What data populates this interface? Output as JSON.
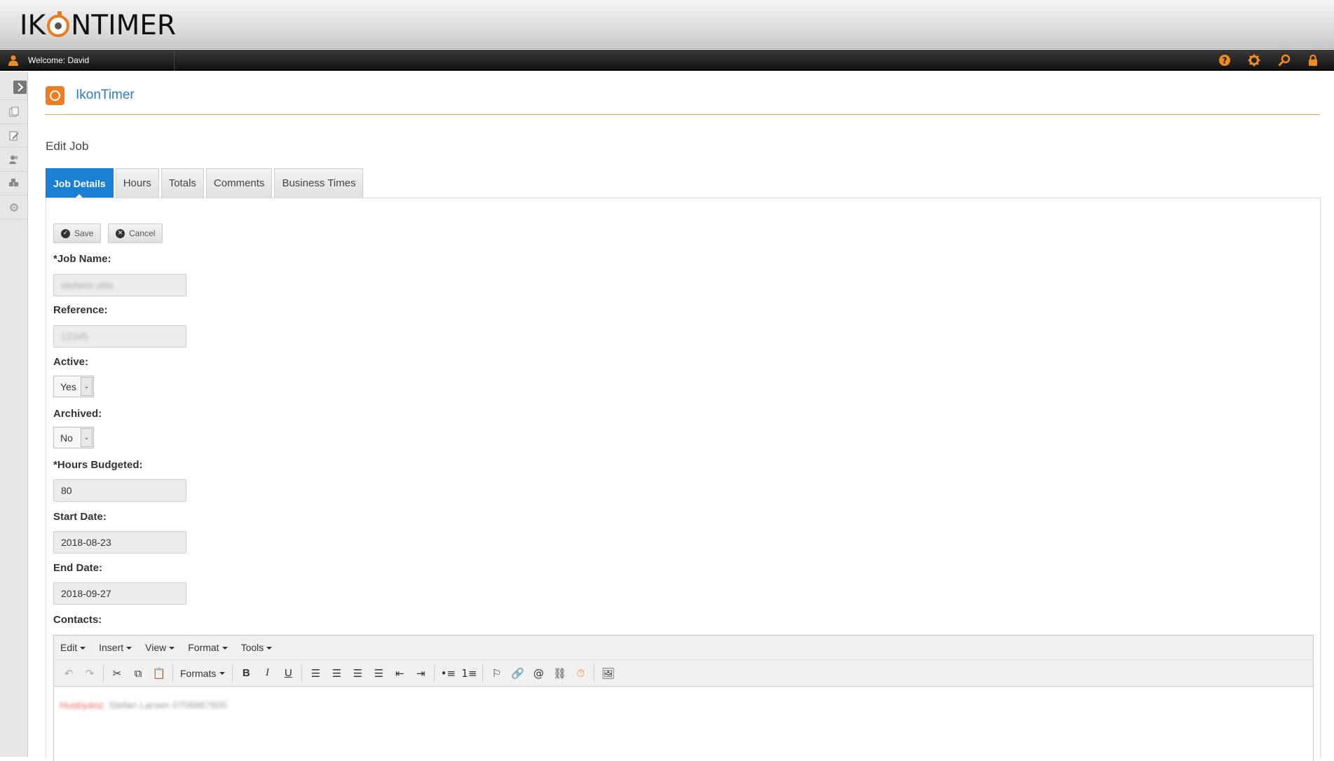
{
  "header": {
    "logo_prefix": "IK",
    "logo_suffix": "NTIMER",
    "welcome": "Welcome: David"
  },
  "app": {
    "title": "IkonTimer"
  },
  "page": {
    "title": "Edit Job"
  },
  "tabs": [
    {
      "label": "Job Details",
      "active": true
    },
    {
      "label": "Hours"
    },
    {
      "label": "Totals"
    },
    {
      "label": "Comments"
    },
    {
      "label": "Business Times"
    }
  ],
  "actions": {
    "save": "Save",
    "cancel": "Cancel"
  },
  "form": {
    "job_name": {
      "label": "*Job Name:",
      "value": "stefano villa"
    },
    "reference": {
      "label": "Reference:",
      "value": "12345"
    },
    "active": {
      "label": "Active:",
      "value": "Yes"
    },
    "archived": {
      "label": "Archived:",
      "value": "No"
    },
    "hours_budgeted": {
      "label": "*Hours Budgeted:",
      "value": "80"
    },
    "start_date": {
      "label": "Start Date:",
      "value": "2018-08-23"
    },
    "end_date": {
      "label": "End Date:",
      "value": "2018-09-27"
    },
    "contacts": {
      "label": "Contacts:"
    }
  },
  "editor": {
    "menus": [
      "Edit",
      "Insert",
      "View",
      "Format",
      "Tools"
    ],
    "formats_label": "Formats",
    "content_label": "Husbyanz:",
    "content_text": "Stefan Larsen 0706867600"
  },
  "colors": {
    "accent": "#1b80d3",
    "brand_orange": "#ed7d22",
    "title_blue": "#2a7ec2"
  }
}
